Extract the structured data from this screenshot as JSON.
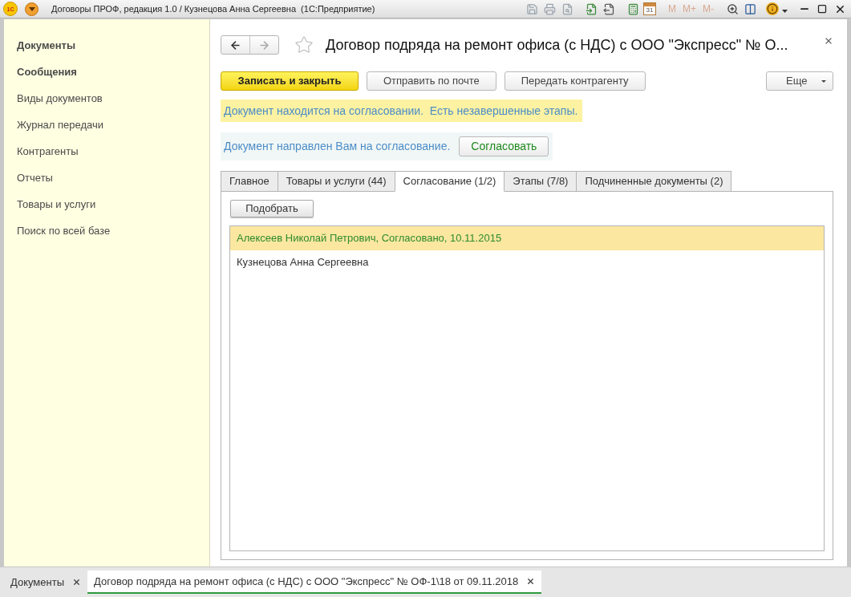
{
  "title_bar": {
    "logo_text": "1С",
    "title": "Договоры ПРОФ, редакция 1.0 / Кузнецова Анна Сергеевна  (1С:Предприятие)",
    "calendar_day": "31",
    "memory_buttons": [
      "M",
      "M+",
      "M-"
    ]
  },
  "sidebar": {
    "items": [
      {
        "label": "Документы",
        "bold": true
      },
      {
        "label": "Сообщения",
        "bold": true
      },
      {
        "label": "Виды документов",
        "bold": false
      },
      {
        "label": "Журнал передачи",
        "bold": false
      },
      {
        "label": "Контрагенты",
        "bold": false
      },
      {
        "label": "Отчеты",
        "bold": false
      },
      {
        "label": "Товары и услуги",
        "bold": false
      },
      {
        "label": "Поиск по всей базе",
        "bold": false
      }
    ]
  },
  "document": {
    "title": "Договор подряда на ремонт офиса (с НДС) с ООО \"Экспресс\" № О...",
    "buttons": [
      {
        "label": "Записать и закрыть",
        "kind": "primary"
      },
      {
        "label": "Отправить по почте",
        "kind": "normal"
      },
      {
        "label": "Передать контрагенту",
        "kind": "normal"
      }
    ],
    "more_button": "Еще",
    "status_banner": "Документ находится на согласовании.  Есть незавершенные этапы.",
    "approval_banner": {
      "text": "Документ направлен Вам на согласование.",
      "button": "Согласовать"
    },
    "tabs": [
      {
        "label": "Главное",
        "selected": false
      },
      {
        "label": "Товары и услуги (44)",
        "selected": false
      },
      {
        "label": "Согласование (1/2)",
        "selected": true
      },
      {
        "label": "Этапы (7/8)",
        "selected": false
      },
      {
        "label": "Подчиненные документы (2)",
        "selected": false
      }
    ],
    "pick_button": "Подобрать",
    "approvers": [
      {
        "text": "Алексеев Николай Петрович, Согласовано, 10.11.2015",
        "selected": true,
        "color": "#2e8b2e"
      },
      {
        "text": "Кузнецова Анна Сергеевна",
        "selected": false,
        "color": "#333333"
      }
    ]
  },
  "window_tabs": [
    {
      "label": "Документы",
      "selected": false
    },
    {
      "label": "Договор подряда на ремонт офиса (с НДС) с ООО \"Экспресс\" № ОФ-1\\18 от 09.11.2018",
      "selected": true
    }
  ]
}
